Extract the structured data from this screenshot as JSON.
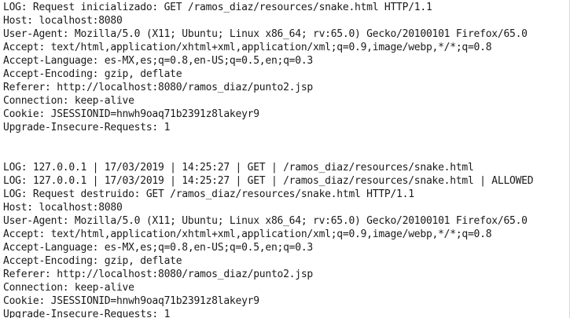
{
  "console": {
    "lines": [
      "LOG: Request inicializado: GET /ramos_diaz/resources/snake.html HTTP/1.1",
      "Host: localhost:8080",
      "User-Agent: Mozilla/5.0 (X11; Ubuntu; Linux x86_64; rv:65.0) Gecko/20100101 Firefox/65.0",
      "Accept: text/html,application/xhtml+xml,application/xml;q=0.9,image/webp,*/*;q=0.8",
      "Accept-Language: es-MX,es;q=0.8,en-US;q=0.5,en;q=0.3",
      "Accept-Encoding: gzip, deflate",
      "Referer: http://localhost:8080/ramos_diaz/punto2.jsp",
      "Connection: keep-alive",
      "Cookie: JSESSIONID=hnwh9oaq71b2391z8lakeyr9",
      "Upgrade-Insecure-Requests: 1",
      "",
      "",
      "LOG: 127.0.0.1 | 17/03/2019 | 14:25:27 | GET | /ramos_diaz/resources/snake.html",
      "LOG: 127.0.0.1 | 17/03/2019 | 14:25:27 | GET | /ramos_diaz/resources/snake.html | ALLOWED",
      "LOG: Request destruido: GET /ramos_diaz/resources/snake.html HTTP/1.1",
      "Host: localhost:8080",
      "User-Agent: Mozilla/5.0 (X11; Ubuntu; Linux x86_64; rv:65.0) Gecko/20100101 Firefox/65.0",
      "Accept: text/html,application/xhtml+xml,application/xml;q=0.9,image/webp,*/*;q=0.8",
      "Accept-Language: es-MX,es;q=0.8,en-US;q=0.5,en;q=0.3",
      "Accept-Encoding: gzip, deflate",
      "Referer: http://localhost:8080/ramos_diaz/punto2.jsp",
      "Connection: keep-alive",
      "Cookie: JSESSIONID=hnwh9oaq71b2391z8lakeyr9",
      "Upgrade-Insecure-Requests: 1"
    ]
  }
}
